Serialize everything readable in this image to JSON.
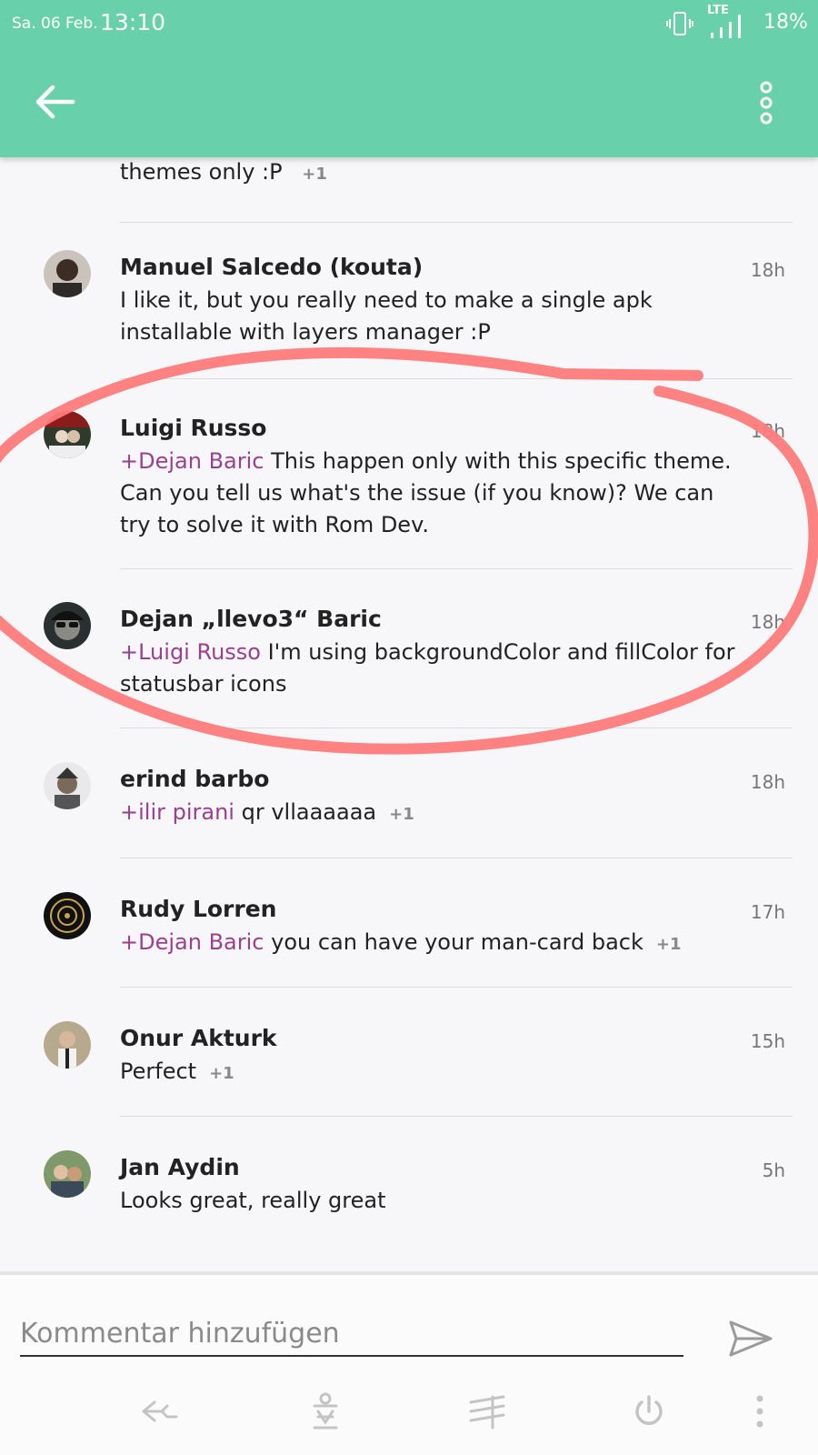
{
  "status_bar": {
    "date": "Sa. 06 Feb.",
    "time": "13:10",
    "network": "LTE",
    "battery": "18%"
  },
  "partial_comment": {
    "text": "themes only :P",
    "plus_one": "+1"
  },
  "comments": [
    {
      "author": "Manuel Salcedo (kouta)",
      "time": "18h",
      "line1": "I like it, but you really need to make a single apk",
      "line2": "installable with layers manager :P"
    },
    {
      "author": "Luigi Russo",
      "time": "18h",
      "mention": "+Dejan Baric",
      "line1_rest": " This happen only with this specific theme.",
      "line2": "Can you tell us what's the issue (if you know)? We can",
      "line3": "try to solve it with Rom Dev."
    },
    {
      "author": "Dejan „llevo3“ Baric",
      "time": "18h",
      "mention": "+Luigi Russo",
      "line1_rest": " I'm using backgroundColor and fillColor for",
      "line2": "statusbar icons"
    },
    {
      "author": "erind barbo",
      "time": "18h",
      "mention": "+ilir pirani",
      "line1_rest": " qr vllaaaaaa",
      "plus_one": "+1"
    },
    {
      "author": "Rudy Lorren",
      "time": "17h",
      "mention": "+Dejan Baric",
      "line1_rest": " you can have your man-card back",
      "plus_one": "+1"
    },
    {
      "author": "Onur Akturk",
      "time": "15h",
      "line1": "Perfect",
      "plus_one": "+1"
    },
    {
      "author": "Jan Aydin",
      "time": "5h",
      "line1": "Looks great, really great"
    }
  ],
  "composer": {
    "placeholder": "Kommentar hinzufügen"
  },
  "colors": {
    "app_bar": "#69d0ac",
    "mention": "#9b3f8f",
    "annotation_circle": "#ff7b7b"
  },
  "icons": {
    "back": "arrow-left-icon",
    "more": "more-vertical-icon",
    "send": "send-icon"
  }
}
